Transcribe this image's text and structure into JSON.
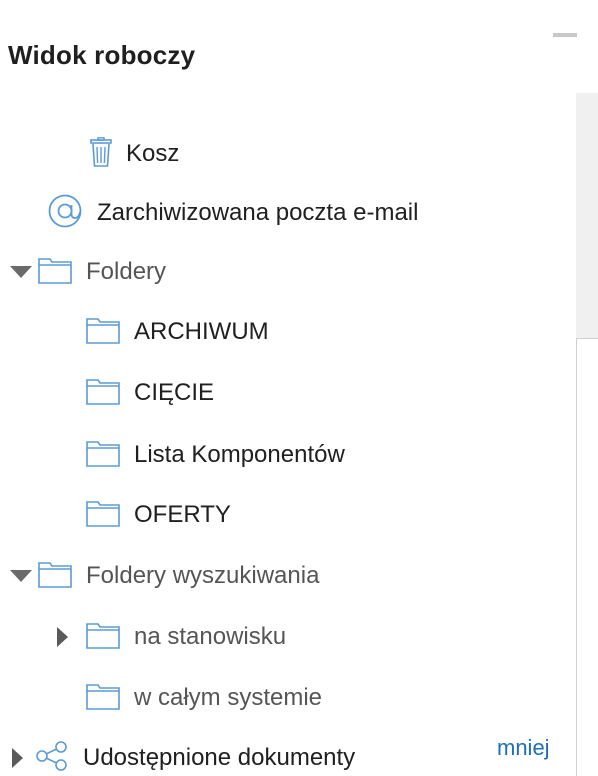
{
  "panel": {
    "title": "Widok roboczy",
    "minimize_icon": "minimize-icon"
  },
  "tree": {
    "items": [
      {
        "label": "Kosz",
        "icon": "trash-icon",
        "toggle": "none"
      },
      {
        "label": "Zarchiwizowana poczta e-mail",
        "icon": "at-sign-icon",
        "toggle": "none"
      },
      {
        "label": "Foldery",
        "icon": "folder-icon",
        "toggle": "expanded"
      },
      {
        "label": "ARCHIWUM",
        "icon": "folder-icon",
        "toggle": "none"
      },
      {
        "label": "CIĘCIE",
        "icon": "folder-icon",
        "toggle": "none"
      },
      {
        "label": "Lista Komponentów",
        "icon": "folder-icon",
        "toggle": "none"
      },
      {
        "label": "OFERTY",
        "icon": "folder-icon",
        "toggle": "none"
      },
      {
        "label": "Foldery wyszukiwania",
        "icon": "folder-icon",
        "toggle": "expanded"
      },
      {
        "label": "na stanowisku",
        "icon": "folder-icon",
        "toggle": "collapsed"
      },
      {
        "label": "w całym systemie",
        "icon": "folder-icon",
        "toggle": "none"
      },
      {
        "label": "Udostępnione dokumenty",
        "icon": "share-icon",
        "toggle": "collapsed"
      }
    ]
  },
  "footer": {
    "more_label": "mniej"
  },
  "colors": {
    "folder_stroke": "#5b9bd5",
    "link": "#1e6fb8",
    "toggle": "#6a6a6a"
  }
}
